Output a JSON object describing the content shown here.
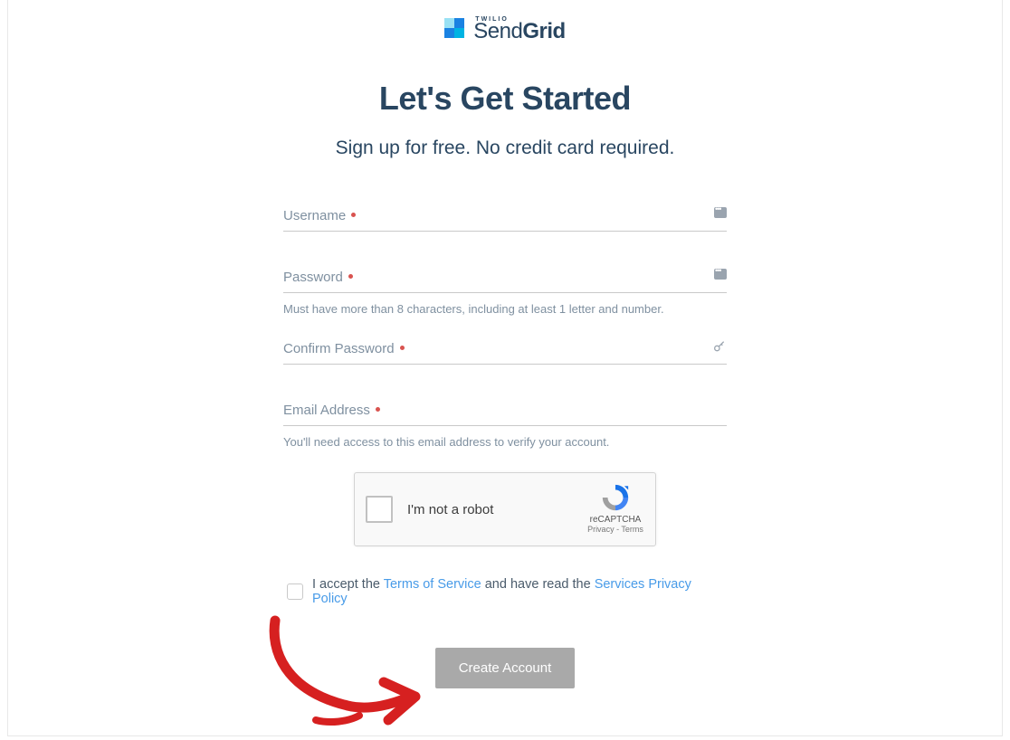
{
  "brand": {
    "twilio": "TWILIO",
    "name_thin": "Send",
    "name_bold": "Grid"
  },
  "heading": "Let's Get Started",
  "subtitle": "Sign up for free. No credit card required.",
  "fields": {
    "username": {
      "label": "Username"
    },
    "password": {
      "label": "Password",
      "helper": "Must have more than 8 characters, including at least 1 letter and number."
    },
    "confirm_password": {
      "label": "Confirm Password"
    },
    "email": {
      "label": "Email Address",
      "helper": "You'll need access to this email address to verify your account."
    }
  },
  "recaptcha": {
    "label": "I'm not a robot",
    "brand": "reCAPTCHA",
    "privacy": "Privacy",
    "terms": "Terms"
  },
  "terms": {
    "prefix": "I accept the ",
    "tos": "Terms of Service",
    "middle": " and have read the ",
    "privacy": "Services Privacy Policy"
  },
  "submit_label": "Create Account"
}
